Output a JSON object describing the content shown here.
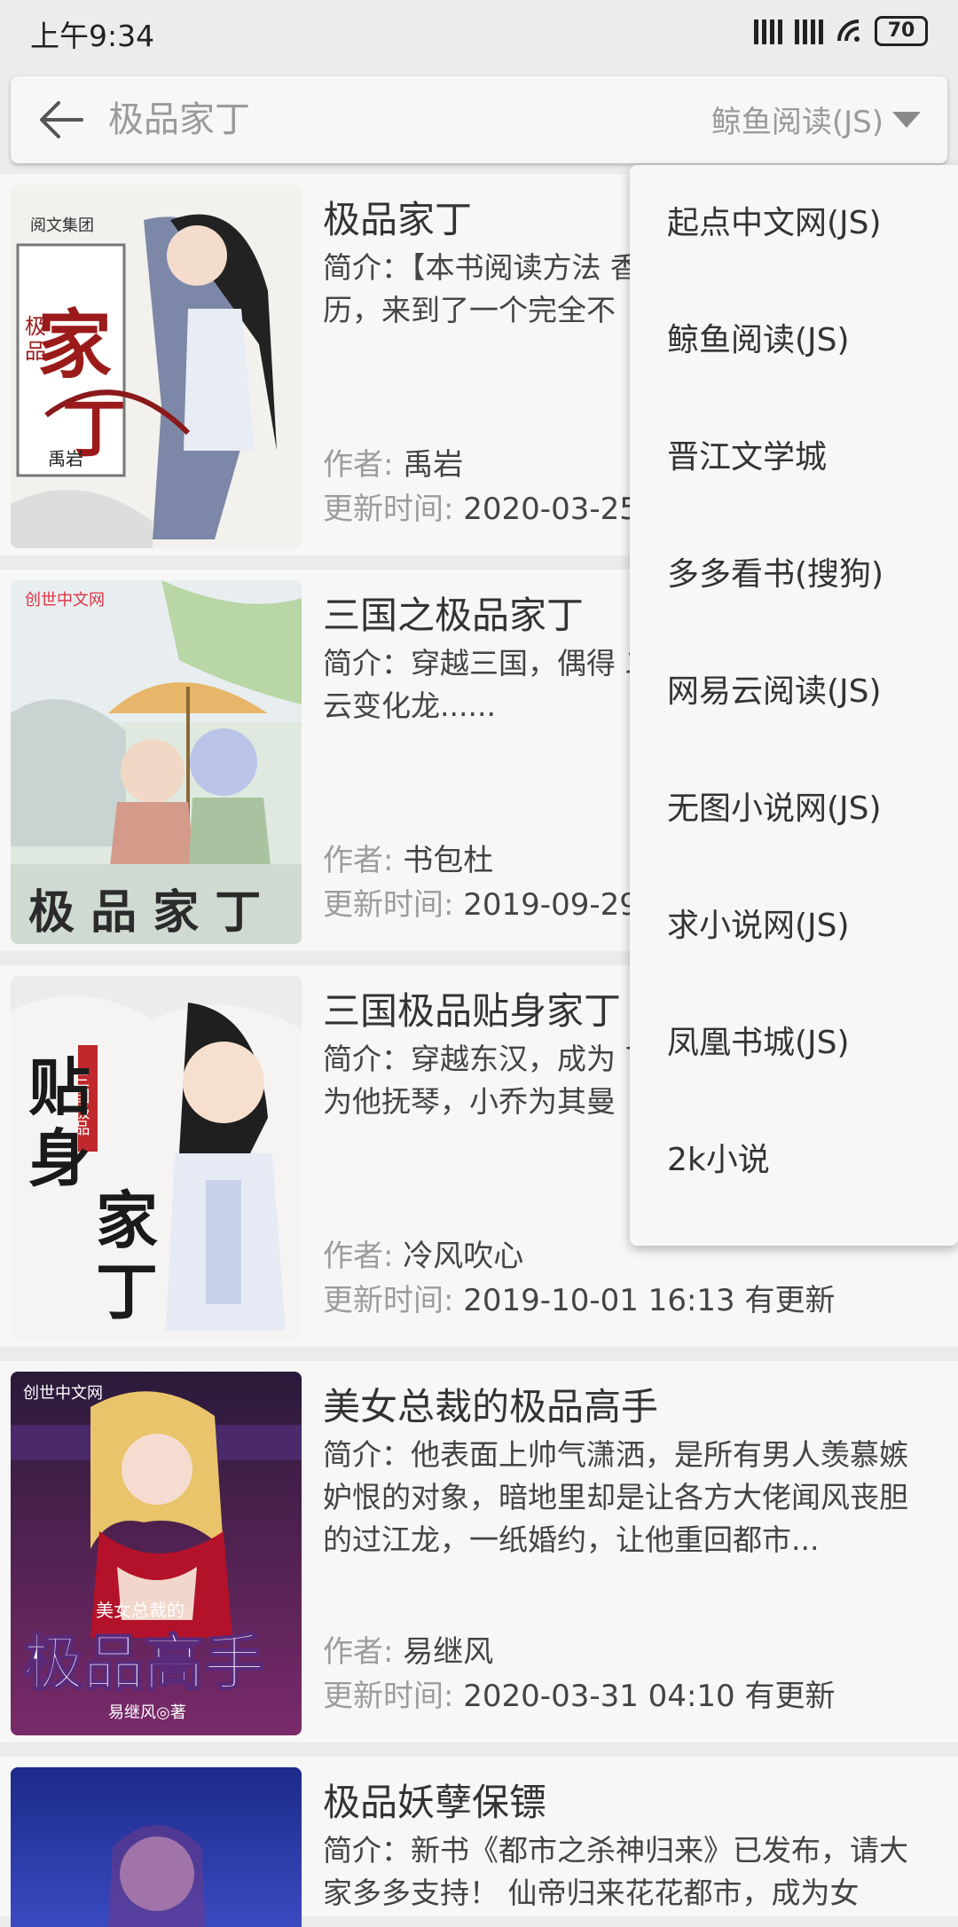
{
  "status": {
    "time": "上午9:34",
    "battery": "70"
  },
  "search": {
    "placeholder": "极品家丁",
    "source_selected": "鲸鱼阅读(JS)"
  },
  "dropdown": {
    "options": [
      "起点中文网(JS)",
      "鲸鱼阅读(JS)",
      "晋江文学城",
      "多多看书(搜狗)",
      "网易云阅读(JS)",
      "无图小说网(JS)",
      "求小说网(JS)",
      "凤凰书城(JS)",
      "2k小说"
    ]
  },
  "labels": {
    "author": "作者:",
    "updated": "更新时间:"
  },
  "books": [
    {
      "title": "极品家丁",
      "intro": "简介：【本书阅读方法 香》！ 年轻的销售经理 历，来到了一个完全不",
      "author": "禹岩",
      "updated": "2020-03-25",
      "cover_text": "极品家丁",
      "cover_author": "禹岩",
      "cover_publisher": "阅文集团"
    },
    {
      "title": "三国之极品家丁",
      "intro": "简介：穿越三国，偶得 二乔家里做家丁.... 家 云变化龙......",
      "author": "书包杜",
      "updated": "2019-09-29",
      "cover_text": "极 品 家 丁",
      "cover_publisher": "创世中文网"
    },
    {
      "title": "三国极品贴身家丁",
      "intro": "简介：穿越东汉，成为 丁。 他吟诗作曲，收了 为他抚琴，小乔为其曼",
      "author": "冷风吹心",
      "updated": "2019-10-01 16:13 有更新",
      "cover_text": "贴身家丁",
      "cover_sub": "三国极品"
    },
    {
      "title": "美女总裁的极品高手",
      "intro": "简介：他表面上帅气潇洒，是所有男人羡慕嫉妒恨的对象，暗地里却是让各方大佬闻风丧胆的过江龙，一纸婚约，让他重回都市...",
      "author": "易继风",
      "updated": "2020-03-31 04:10 有更新",
      "cover_text": "极品高手",
      "cover_sub": "美女总裁的",
      "cover_author": "易继风◎著",
      "cover_publisher": "创世中文网"
    },
    {
      "title": "极品妖孽保镖",
      "intro": "简介：新书《都市之杀神归来》已发布，请大家多多支持！ 仙帝归来花花都市，成为女",
      "author": "",
      "updated": ""
    }
  ],
  "colors": {
    "row_bg": "#f7f7f7",
    "divider": "#ebebeb",
    "label": "#9c9c9c"
  }
}
